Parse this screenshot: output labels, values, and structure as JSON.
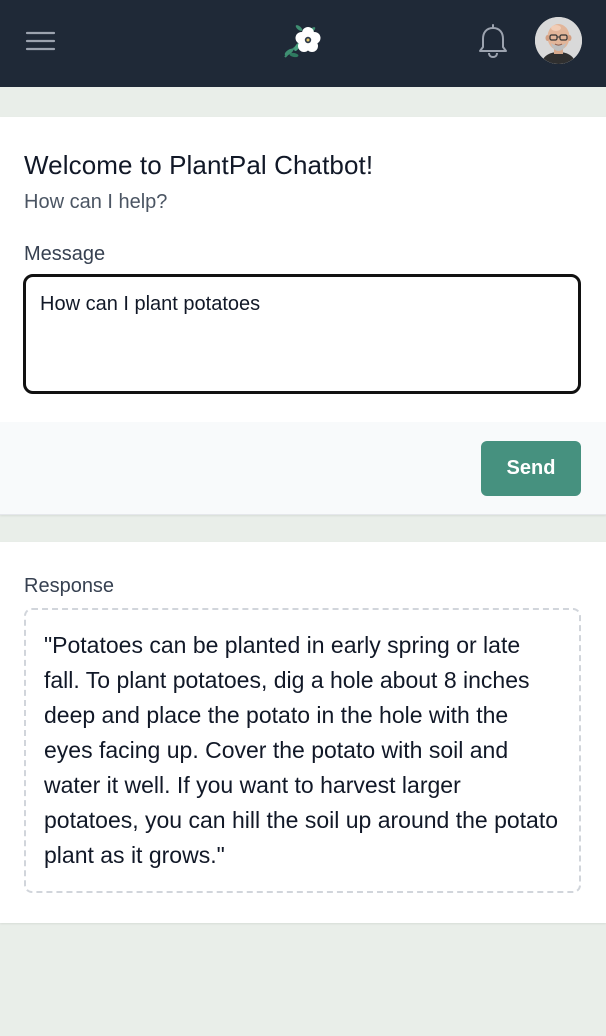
{
  "header": {
    "menu_icon": "hamburger-menu-icon",
    "logo_icon": "flower-logo-icon",
    "bell_icon": "notification-bell-icon",
    "avatar_icon": "user-avatar",
    "colors": {
      "background": "#1f2937",
      "icon": "#9ca3af"
    }
  },
  "chat": {
    "title": "Welcome to PlantPal Chatbot!",
    "subtitle": "How can I help?",
    "message_label": "Message",
    "message_value": "How can I plant potatoes",
    "send_label": "Send"
  },
  "response": {
    "label": "Response",
    "text": "\"Potatoes can be planted in early spring or late fall. To plant potatoes, dig a hole about 8 inches deep and place the potato in the hole with the eyes facing up. Cover the potato with soil and water it well. If you want to harvest larger potatoes, you can hill the soil up around the potato plant as it grows.\""
  },
  "colors": {
    "accent": "#46917f",
    "page_bg": "#e9eee9"
  }
}
